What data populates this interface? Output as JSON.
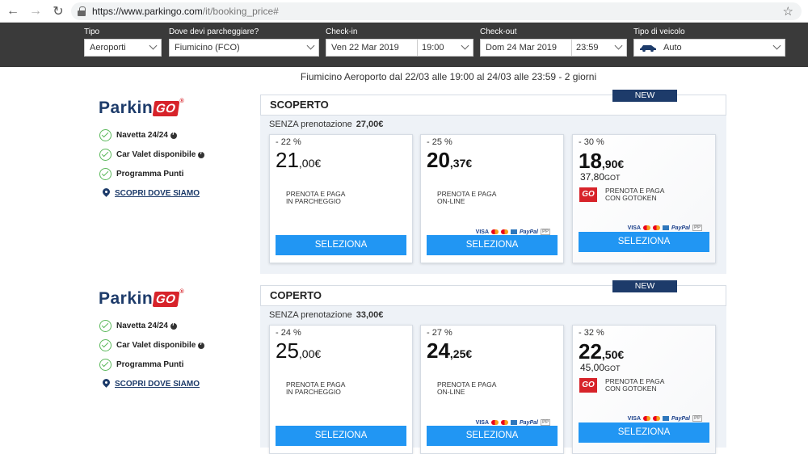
{
  "browser": {
    "url_domain": "https://www.parkingo.com",
    "url_path": "/it/booking_price#"
  },
  "search": {
    "tipo_label": "Tipo",
    "tipo_value": "Aeroporti",
    "where_label": "Dove devi parcheggiare?",
    "where_value": "Fiumicino (FCO)",
    "checkin_label": "Check-in",
    "checkin_date": "Ven 22 Mar 2019",
    "checkin_time": "19:00",
    "checkout_label": "Check-out",
    "checkout_date": "Dom 24 Mar 2019",
    "checkout_time": "23:59",
    "vehicle_label": "Tipo di veicolo",
    "vehicle_value": "Auto"
  },
  "summary": "Fiumicino Aeroporto dal 22/03 alle 19:00 al 24/03 alle 23:59 - 2 giorni",
  "brand": {
    "name": "Parkin",
    "go": "GO",
    "reg": "®"
  },
  "features": {
    "shuttle": "Navetta 24/24",
    "valet": "Car Valet disponibile",
    "points": "Programma Punti",
    "discover": "SCOPRI DOVE SIAMO"
  },
  "payments": {
    "visa": "VISA",
    "paypal": "PayPal",
    "pp2": "PP"
  },
  "sections": [
    {
      "title": "SCOPERTO",
      "no_res_label": "SENZA prenotazione",
      "no_res_price": "27,00€",
      "cards": [
        {
          "discount": "- 22 %",
          "price_int": "21",
          "price_cents": ",00€",
          "desc1": "PRENOTA E PAGA",
          "desc2": "IN PARCHEGGIO",
          "button": "SELEZIONA"
        },
        {
          "discount": "- 25 %",
          "price_int": "20",
          "price_cents": ",37€",
          "desc1": "PRENOTA E PAGA",
          "desc2": "ON-LINE",
          "button": "SELEZIONA"
        },
        {
          "badge": "NEW",
          "discount": "- 30 %",
          "price_int": "18",
          "price_cents": ",90€",
          "got_amount": "37,80",
          "got_unit": "GOT",
          "go_logo": "GO",
          "desc1": "PRENOTA E PAGA",
          "desc2": "CON GOTOKEN",
          "button": "SELEZIONA"
        }
      ]
    },
    {
      "title": "COPERTO",
      "no_res_label": "SENZA prenotazione",
      "no_res_price": "33,00€",
      "cards": [
        {
          "discount": "- 24 %",
          "price_int": "25",
          "price_cents": ",00€",
          "desc1": "PRENOTA E PAGA",
          "desc2": "IN PARCHEGGIO",
          "button": "SELEZIONA"
        },
        {
          "discount": "- 27 %",
          "price_int": "24",
          "price_cents": ",25€",
          "desc1": "PRENOTA E PAGA",
          "desc2": "ON-LINE",
          "button": "SELEZIONA"
        },
        {
          "badge": "NEW",
          "discount": "- 32 %",
          "price_int": "22",
          "price_cents": ",50€",
          "got_amount": "45,00",
          "got_unit": "GOT",
          "go_logo": "GO",
          "desc1": "PRENOTA E PAGA",
          "desc2": "CON GOTOKEN",
          "button": "SELEZIONA"
        }
      ]
    }
  ]
}
